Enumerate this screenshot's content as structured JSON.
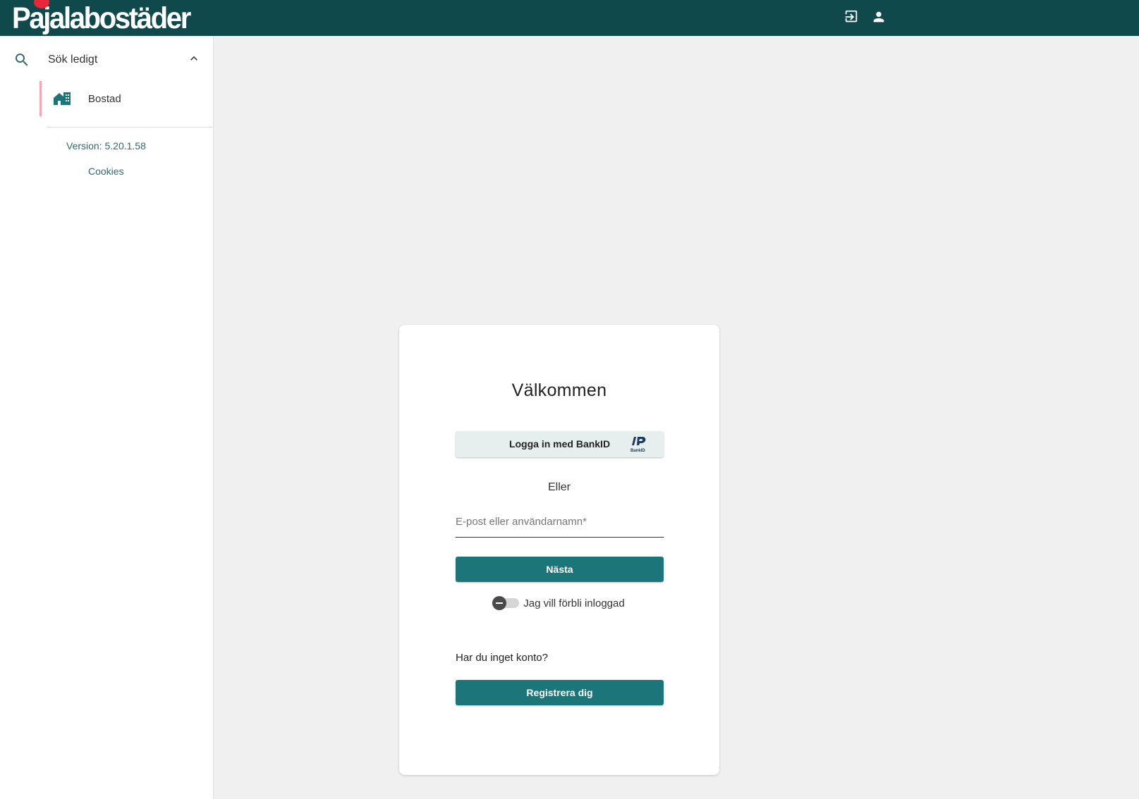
{
  "header": {
    "logo_text": "Pajalabostäder",
    "icons": [
      "login-icon",
      "account-icon"
    ],
    "background": "#0f494c"
  },
  "sidebar": {
    "search_label": "Sök ledigt",
    "items": [
      {
        "label": "Bostad",
        "icon": "building-icon"
      }
    ],
    "version": "Version: 5.20.1.58",
    "cookies": "Cookies"
  },
  "login": {
    "title": "Välkommen",
    "bankid_label": "Logga in med BankID",
    "bankid_logo_text": "BankID",
    "or": "Eller",
    "email_placeholder": "E-post eller användarnamn*",
    "next_label": "Nästa",
    "remember_label": "Jag vill förbli inloggad",
    "no_account": "Har du inget konto?",
    "register_label": "Registrera dig"
  },
  "colors": {
    "primary": "#1c7679",
    "header": "#0f494c",
    "accent_border": "#f2a8b3",
    "logo_dot": "#e8263a"
  }
}
